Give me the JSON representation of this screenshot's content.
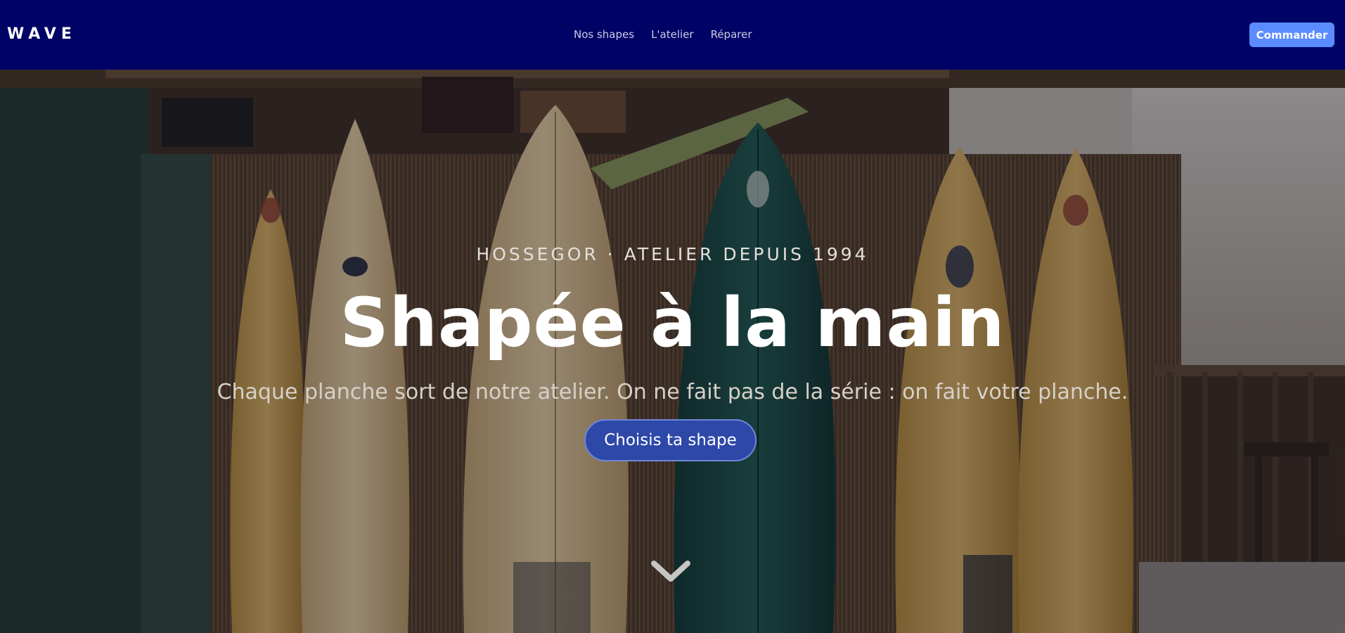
{
  "nav": {
    "brand": "WAVE",
    "links": [
      {
        "label": "Nos shapes"
      },
      {
        "label": "L'atelier"
      },
      {
        "label": "Réparer"
      }
    ],
    "cta_label": "Commander"
  },
  "hero": {
    "eyebrow": "HOSSEGOR · ATELIER DEPUIS 1994",
    "headline": "Shapée à la main",
    "subtitle": "Chaque planche sort de notre atelier. On ne fait pas de la série : on fait votre planche.",
    "cta_label": "Choisis ta shape",
    "scroll_icon": "chevron-down-icon",
    "background_image": "surfboards-workshop-photo"
  },
  "colors": {
    "nav_bg": "#000366",
    "nav_cta_bg": "#5b8cff",
    "hero_cta_bg": "#2e48a8",
    "hero_cta_border": "#6f86d8",
    "text_white": "#ffffff"
  }
}
